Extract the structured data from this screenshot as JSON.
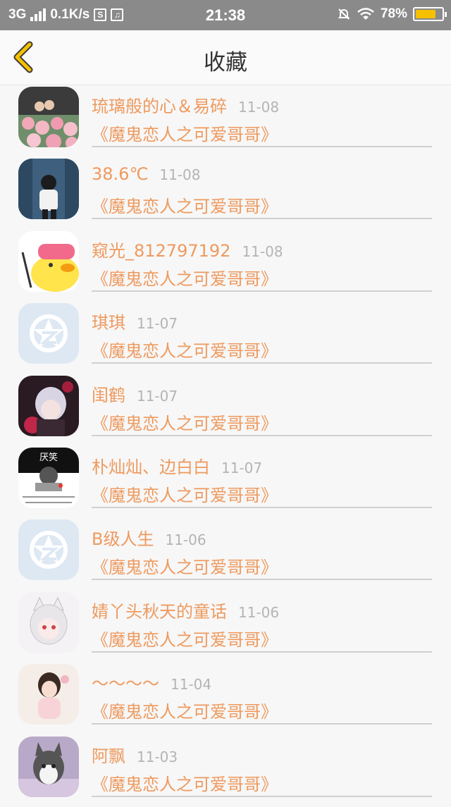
{
  "status_bar": {
    "network": "3G",
    "speed": "0.1K/s",
    "time": "21:38",
    "battery": "78%",
    "battery_level": 0.78,
    "icons": [
      "signal-icon",
      "s-app-icon",
      "music-icon",
      "mute-bell-icon",
      "wifi-icon",
      "battery-icon"
    ]
  },
  "header": {
    "title": "收藏",
    "back_icon": "chevron-left-icon",
    "accent": "#f5c000"
  },
  "colors": {
    "name": "#ee9a5f",
    "date": "#b4b4b4",
    "divider": "#d0d0d0"
  },
  "items": [
    {
      "name": "琉璃般的心＆易碎",
      "date": "11-08",
      "subtitle": "《魔鬼恋人之可爱哥哥》",
      "avatar": "photo-avatar-flowers"
    },
    {
      "name": "38.6℃",
      "date": "11-08",
      "subtitle": "《魔鬼恋人之可爱哥哥》",
      "avatar": "photo-avatar-girl"
    },
    {
      "name": "窥光_812797192",
      "date": "11-08",
      "subtitle": "《魔鬼恋人之可爱哥哥》",
      "avatar": "cartoon-avatar-duck"
    },
    {
      "name": "琪琪",
      "date": "11-07",
      "subtitle": "《魔鬼恋人之可爱哥哥》",
      "avatar": "default-star-avatar"
    },
    {
      "name": "闺鹤",
      "date": "11-07",
      "subtitle": "《魔鬼恋人之可爱哥哥》",
      "avatar": "anime-avatar-boy"
    },
    {
      "name": "朴灿灿、边白白",
      "date": "11-07",
      "subtitle": "《魔鬼恋人之可爱哥哥》",
      "avatar": "text-avatar-black"
    },
    {
      "name": "B级人生",
      "date": "11-06",
      "subtitle": "《魔鬼恋人之可爱哥哥》",
      "avatar": "default-star-avatar"
    },
    {
      "name": "婧丫头秋天的童话",
      "date": "11-06",
      "subtitle": "《魔鬼恋人之可爱哥哥》",
      "avatar": "anime-avatar-cat-girl"
    },
    {
      "name": "～～～～",
      "date": "11-04",
      "subtitle": "《魔鬼恋人之可爱哥哥》",
      "avatar": "illustration-avatar-girl"
    },
    {
      "name": "阿飘",
      "date": "11-03",
      "subtitle": "《魔鬼恋人之可爱哥哥》",
      "avatar": "photo-avatar-husky"
    }
  ]
}
